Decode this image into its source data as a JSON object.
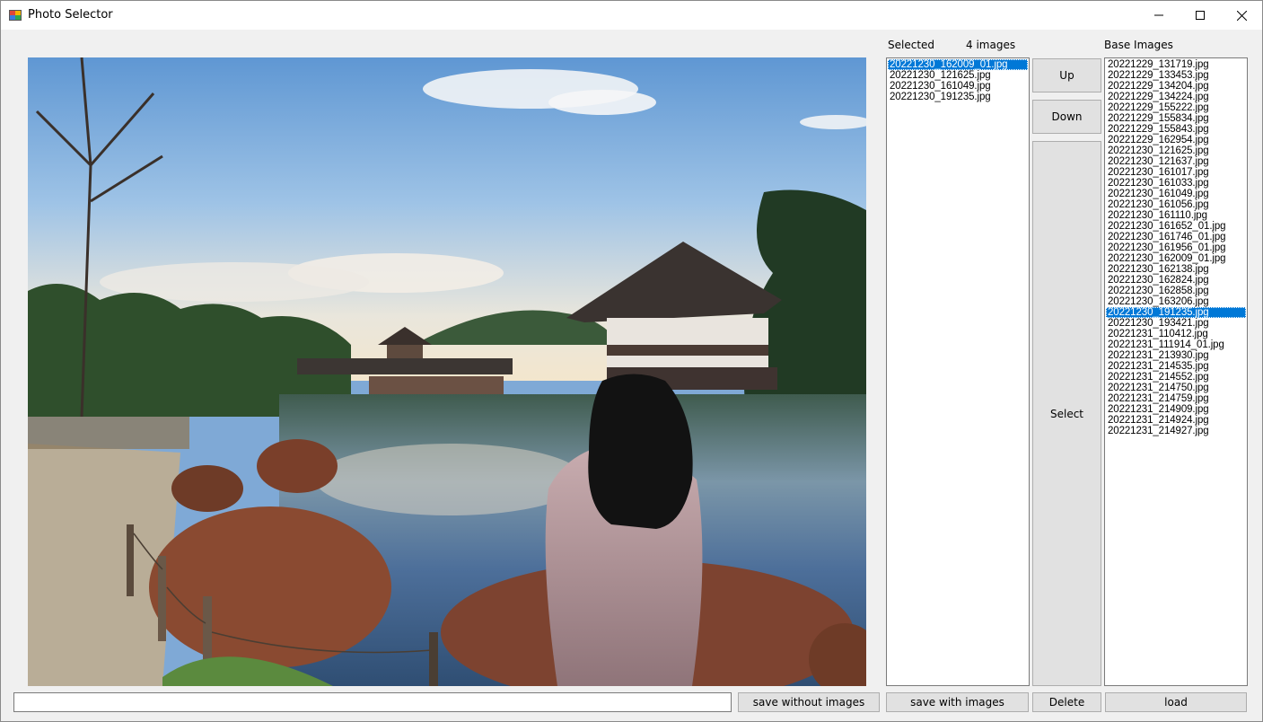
{
  "window": {
    "title": "Photo Selector"
  },
  "labels": {
    "selected": "Selected",
    "count": "4 images",
    "base_images": "Base Images"
  },
  "buttons": {
    "up": "Up",
    "down": "Down",
    "select": "Select",
    "save_without_images": "save without images",
    "save_with_images": "save with images",
    "delete": "Delete",
    "load": "load"
  },
  "path_input": {
    "value": ""
  },
  "selected_list": {
    "items": [
      "20221230_162009_01.jpg",
      "20221230_121625.jpg",
      "20221230_161049.jpg",
      "20221230_191235.jpg"
    ],
    "selected_index": 0
  },
  "base_list": {
    "items": [
      "20221229_131719.jpg",
      "20221229_133453.jpg",
      "20221229_134204.jpg",
      "20221229_134224.jpg",
      "20221229_155222.jpg",
      "20221229_155834.jpg",
      "20221229_155843.jpg",
      "20221229_162954.jpg",
      "20221230_121625.jpg",
      "20221230_121637.jpg",
      "20221230_161017.jpg",
      "20221230_161033.jpg",
      "20221230_161049.jpg",
      "20221230_161056.jpg",
      "20221230_161110.jpg",
      "20221230_161652_01.jpg",
      "20221230_161746_01.jpg",
      "20221230_161956_01.jpg",
      "20221230_162009_01.jpg",
      "20221230_162138.jpg",
      "20221230_162824.jpg",
      "20221230_162858.jpg",
      "20221230_163206.jpg",
      "20221230_191235.jpg",
      "20221230_193421.jpg",
      "20221231_110412.jpg",
      "20221231_111914_01.jpg",
      "20221231_213930.jpg",
      "20221231_214535.jpg",
      "20221231_214552.jpg",
      "20221231_214750.jpg",
      "20221231_214759.jpg",
      "20221231_214909.jpg",
      "20221231_214924.jpg",
      "20221231_214927.jpg"
    ],
    "selected_index": 23
  },
  "colors": {
    "selection": "#0078d7",
    "window_bg": "#f0f0f0",
    "button_bg": "#e1e1e1"
  },
  "icons": {
    "app": "app-icon",
    "minimize": "minimize-icon",
    "maximize": "maximize-icon",
    "close": "close-icon"
  }
}
